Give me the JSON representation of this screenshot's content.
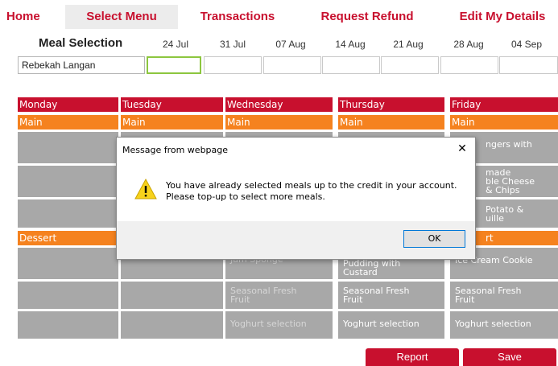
{
  "nav": {
    "items": [
      {
        "label": "Home"
      },
      {
        "label": "Select Menu"
      },
      {
        "label": "Transactions"
      },
      {
        "label": "Request Refund"
      },
      {
        "label": "Edit My Details"
      }
    ]
  },
  "meal_selection": {
    "title": "Meal Selection",
    "dates": [
      "24 Jul",
      "31 Jul",
      "07 Aug",
      "14 Aug",
      "21 Aug",
      "28 Aug",
      "04 Sep"
    ],
    "name": "Rebekah Langan"
  },
  "grid": {
    "days": [
      "Monday",
      "Tuesday",
      "Wednesday",
      "Thursday",
      "Friday"
    ],
    "main_label": "Main",
    "dessert_label": "Dessert",
    "friday_main_1": "ngers with",
    "friday_main_2": "made\nble Cheese\n& Chips",
    "friday_main_3": "Potato &\nuille",
    "dessert_friday_label": "rt",
    "wed_dessert_1": "Jam Sponge",
    "thu_dessert_1": "Pudding with\nCustard",
    "fri_dessert_1": "Ice Cream Cookie",
    "wed_dessert_2": "Seasonal Fresh\nFruit",
    "thu_dessert_2": "Seasonal Fresh\nFruit",
    "fri_dessert_2": "Seasonal Fresh\nFruit",
    "wed_dessert_3": "Yoghurt selection",
    "thu_dessert_3": "Yoghurt selection",
    "fri_dessert_3": "Yoghurt selection"
  },
  "dialog": {
    "title": "Message from webpage",
    "close": "✕",
    "message": "You have already selected meals up to the credit in your account. Please top-up to select more meals.",
    "ok": "OK"
  },
  "buttons": {
    "report": "Report",
    "save": "Save"
  },
  "colors": {
    "brand_red": "#c8102e",
    "section_orange": "#f5821f",
    "cell_grey": "#a8a8a8",
    "selected_green": "#8cc63f"
  }
}
